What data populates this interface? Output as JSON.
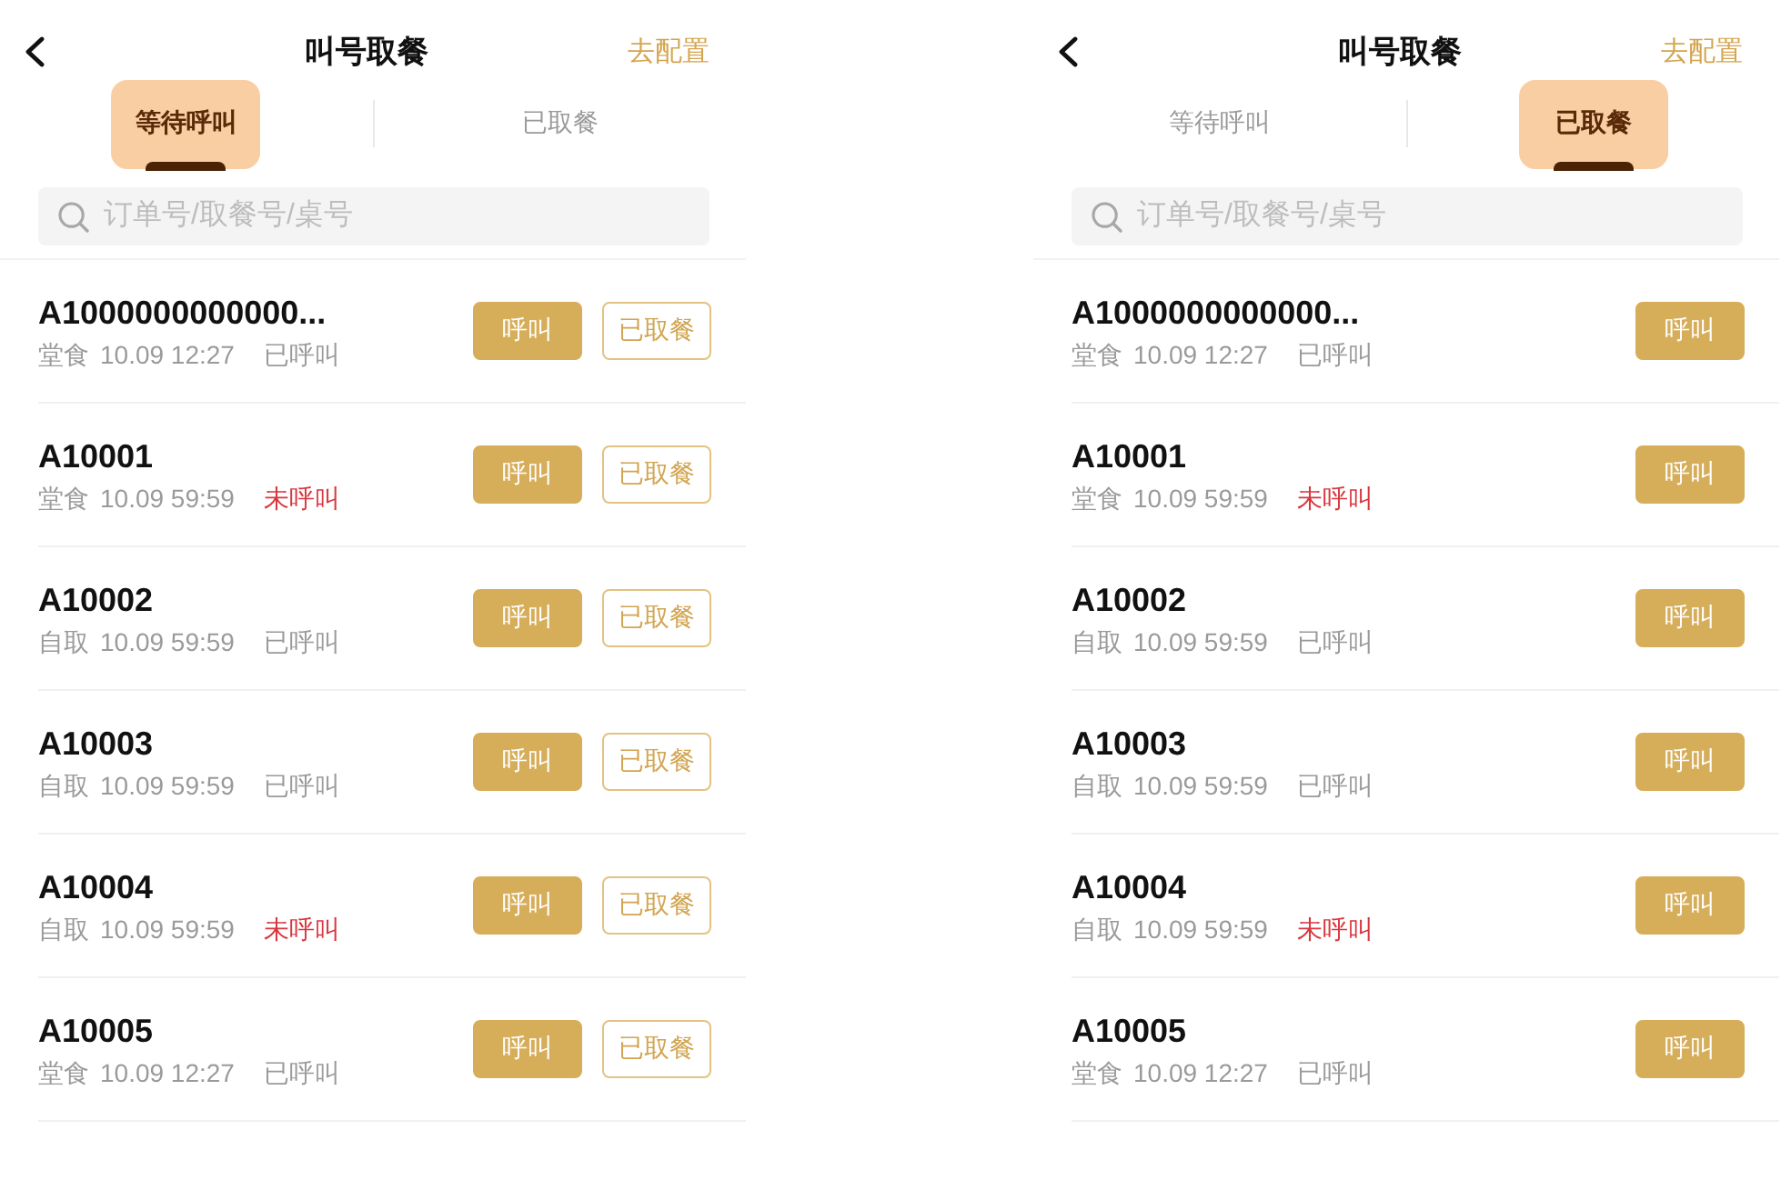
{
  "screens": [
    {
      "title": "叫号取餐",
      "action": "去配置",
      "tabs": [
        {
          "label": "等待呼叫",
          "selected": true
        },
        {
          "label": "已取餐",
          "selected": false
        }
      ],
      "search": {
        "placeholder": "订单号/取餐号/桌号"
      },
      "orders": [
        {
          "number": "A1000000000000...",
          "order_type": "堂食",
          "time": "10.09 12:27",
          "call_status": "已呼叫",
          "called": true,
          "actions": [
            {
              "label": "呼叫",
              "kind": "primary"
            },
            {
              "label": "已取餐",
              "kind": "outline"
            }
          ]
        },
        {
          "number": "A10001",
          "order_type": "堂食",
          "time": "10.09 59:59",
          "call_status": "未呼叫",
          "called": false,
          "actions": [
            {
              "label": "呼叫",
              "kind": "primary"
            },
            {
              "label": "已取餐",
              "kind": "outline"
            }
          ]
        },
        {
          "number": "A10002",
          "order_type": "自取",
          "time": "10.09 59:59",
          "call_status": "已呼叫",
          "called": true,
          "actions": [
            {
              "label": "呼叫",
              "kind": "primary"
            },
            {
              "label": "已取餐",
              "kind": "outline"
            }
          ]
        },
        {
          "number": "A10003",
          "order_type": "自取",
          "time": "10.09 59:59",
          "call_status": "已呼叫",
          "called": true,
          "actions": [
            {
              "label": "呼叫",
              "kind": "primary"
            },
            {
              "label": "已取餐",
              "kind": "outline"
            }
          ]
        },
        {
          "number": "A10004",
          "order_type": "自取",
          "time": "10.09 59:59",
          "call_status": "未呼叫",
          "called": false,
          "actions": [
            {
              "label": "呼叫",
              "kind": "primary"
            },
            {
              "label": "已取餐",
              "kind": "outline"
            }
          ]
        },
        {
          "number": "A10005",
          "order_type": "堂食",
          "time": "10.09 12:27",
          "call_status": "已呼叫",
          "called": true,
          "actions": [
            {
              "label": "呼叫",
              "kind": "primary"
            },
            {
              "label": "已取餐",
              "kind": "outline"
            }
          ]
        }
      ]
    },
    {
      "title": "叫号取餐",
      "action": "去配置",
      "tabs": [
        {
          "label": "等待呼叫",
          "selected": false
        },
        {
          "label": "已取餐",
          "selected": true
        }
      ],
      "search": {
        "placeholder": "订单号/取餐号/桌号"
      },
      "orders": [
        {
          "number": "A1000000000000...",
          "order_type": "堂食",
          "time": "10.09 12:27",
          "call_status": "已呼叫",
          "called": true,
          "actions": [
            {
              "label": "呼叫",
              "kind": "primary"
            }
          ]
        },
        {
          "number": "A10001",
          "order_type": "堂食",
          "time": "10.09 59:59",
          "call_status": "未呼叫",
          "called": false,
          "actions": [
            {
              "label": "呼叫",
              "kind": "primary"
            }
          ]
        },
        {
          "number": "A10002",
          "order_type": "自取",
          "time": "10.09 59:59",
          "call_status": "已呼叫",
          "called": true,
          "actions": [
            {
              "label": "呼叫",
              "kind": "primary"
            }
          ]
        },
        {
          "number": "A10003",
          "order_type": "自取",
          "time": "10.09 59:59",
          "call_status": "已呼叫",
          "called": true,
          "actions": [
            {
              "label": "呼叫",
              "kind": "primary"
            }
          ]
        },
        {
          "number": "A10004",
          "order_type": "自取",
          "time": "10.09 59:59",
          "call_status": "未呼叫",
          "called": false,
          "actions": [
            {
              "label": "呼叫",
              "kind": "primary"
            }
          ]
        },
        {
          "number": "A10005",
          "order_type": "堂食",
          "time": "10.09 12:27",
          "call_status": "已呼叫",
          "called": true,
          "actions": [
            {
              "label": "呼叫",
              "kind": "primary"
            }
          ]
        }
      ]
    }
  ]
}
